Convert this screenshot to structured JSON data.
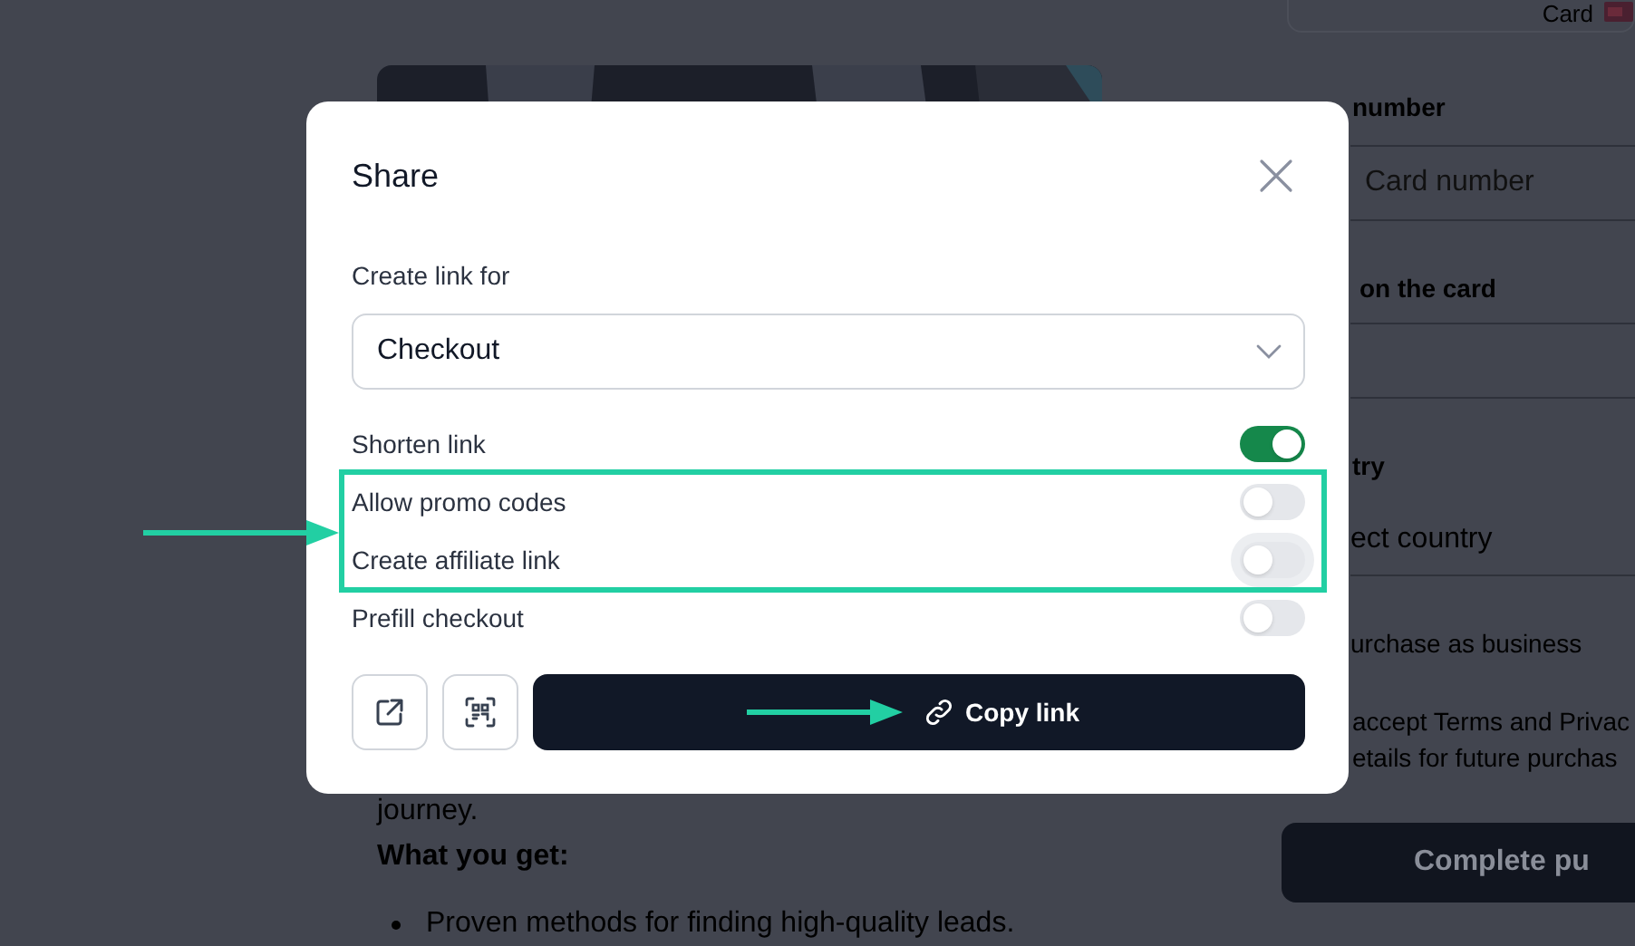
{
  "background": {
    "card_tab": "Card",
    "left": [
      {
        "kind": "picture"
      },
      {
        "kind": "paragraph",
        "text": "journey."
      },
      {
        "kind": "heading",
        "text": "What you get:"
      },
      {
        "kind": "bullet",
        "text": "Proven methods for finding high-quality leads."
      }
    ],
    "form": [
      {
        "kind": "label",
        "text": "number"
      },
      {
        "kind": "input",
        "placeholder": "Card number"
      },
      {
        "kind": "label",
        "text": "on the card"
      },
      {
        "kind": "input"
      },
      {
        "kind": "label",
        "text": "try"
      },
      {
        "kind": "select",
        "value": "ect country"
      },
      {
        "kind": "checkbox",
        "text": "urchase as business"
      },
      {
        "kind": "paragraph",
        "lines": [
          "accept Terms and Privac",
          "etails for future purchas"
        ]
      },
      {
        "kind": "button",
        "text": "Complete pu"
      }
    ]
  },
  "share_dialog": {
    "title": "Share",
    "link_for": {
      "label": "Create link for",
      "value": "Checkout"
    },
    "options": [
      {
        "label": "Shorten link",
        "on": true,
        "hovered": false,
        "highlighted": false
      },
      {
        "label": "Allow promo codes",
        "on": false,
        "hovered": false,
        "highlighted": true
      },
      {
        "label": "Create affiliate link",
        "on": false,
        "hovered": true,
        "highlighted": true
      },
      {
        "label": "Prefill checkout",
        "on": false,
        "hovered": false,
        "highlighted": false
      }
    ],
    "actions": [
      {
        "kind": "open"
      },
      {
        "kind": "qr"
      },
      {
        "kind": "copy",
        "label": "Copy link",
        "pointer_arrow": true
      }
    ]
  }
}
